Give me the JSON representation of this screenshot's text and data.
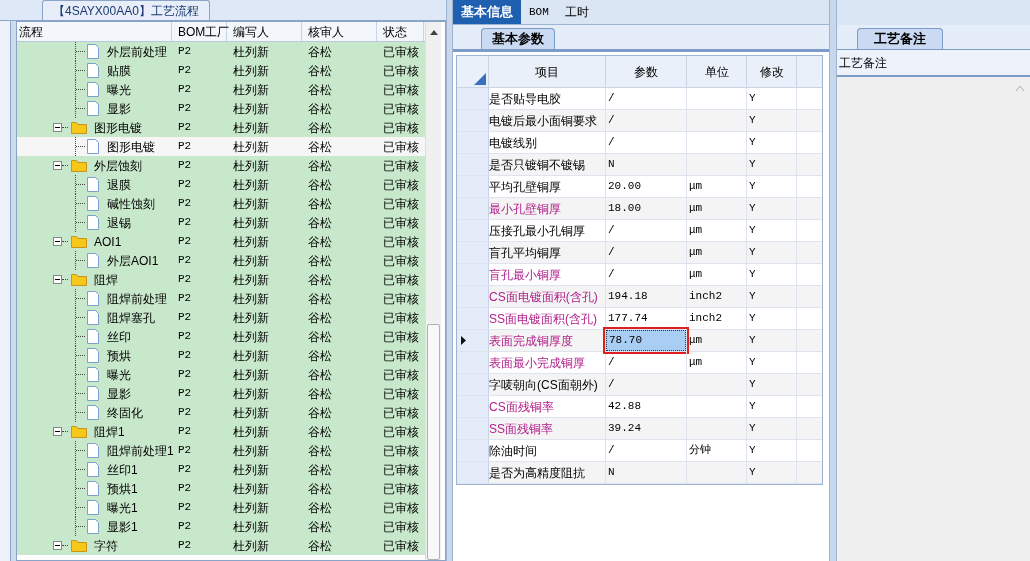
{
  "flow_panel": {
    "title": "【4SAYX00AA0】工艺流程",
    "columns": [
      "流程",
      "BOM工厂",
      "编写人",
      "核审人",
      "状态"
    ],
    "tree": [
      {
        "kind": "leaf",
        "label": "外层前处理",
        "factory": "P2",
        "writer": "杜列新",
        "reviewer": "谷松",
        "status": "已审核",
        "selected": false
      },
      {
        "kind": "leaf",
        "label": "贴膜",
        "factory": "P2",
        "writer": "杜列新",
        "reviewer": "谷松",
        "status": "已审核",
        "selected": false
      },
      {
        "kind": "leaf",
        "label": "曝光",
        "factory": "P2",
        "writer": "杜列新",
        "reviewer": "谷松",
        "status": "已审核",
        "selected": false
      },
      {
        "kind": "leaf",
        "label": "显影",
        "factory": "P2",
        "writer": "杜列新",
        "reviewer": "谷松",
        "status": "已审核",
        "selected": false
      },
      {
        "kind": "folder",
        "label": "图形电镀",
        "factory": "P2",
        "writer": "杜列新",
        "reviewer": "谷松",
        "status": "已审核",
        "selected": false,
        "expanded": true,
        "children": [
          {
            "kind": "leaf",
            "label": "图形电镀",
            "factory": "P2",
            "writer": "杜列新",
            "reviewer": "谷松",
            "status": "已审核",
            "selected": true
          }
        ]
      },
      {
        "kind": "folder",
        "label": "外层蚀刻",
        "factory": "P2",
        "writer": "杜列新",
        "reviewer": "谷松",
        "status": "已审核",
        "selected": false,
        "expanded": true,
        "children": [
          {
            "kind": "leaf",
            "label": "退膜",
            "factory": "P2",
            "writer": "杜列新",
            "reviewer": "谷松",
            "status": "已审核",
            "selected": false
          },
          {
            "kind": "leaf",
            "label": "碱性蚀刻",
            "factory": "P2",
            "writer": "杜列新",
            "reviewer": "谷松",
            "status": "已审核",
            "selected": false
          },
          {
            "kind": "leaf",
            "label": "退锡",
            "factory": "P2",
            "writer": "杜列新",
            "reviewer": "谷松",
            "status": "已审核",
            "selected": false
          }
        ]
      },
      {
        "kind": "folder",
        "label": "AOI1",
        "factory": "P2",
        "writer": "杜列新",
        "reviewer": "谷松",
        "status": "已审核",
        "selected": false,
        "expanded": true,
        "children": [
          {
            "kind": "leaf",
            "label": "外层AOI1",
            "factory": "P2",
            "writer": "杜列新",
            "reviewer": "谷松",
            "status": "已审核",
            "selected": false
          }
        ]
      },
      {
        "kind": "folder",
        "label": "阻焊",
        "factory": "P2",
        "writer": "杜列新",
        "reviewer": "谷松",
        "status": "已审核",
        "selected": false,
        "expanded": true,
        "children": [
          {
            "kind": "leaf",
            "label": "阻焊前处理",
            "factory": "P2",
            "writer": "杜列新",
            "reviewer": "谷松",
            "status": "已审核",
            "selected": false
          },
          {
            "kind": "leaf",
            "label": "阻焊塞孔",
            "factory": "P2",
            "writer": "杜列新",
            "reviewer": "谷松",
            "status": "已审核",
            "selected": false
          },
          {
            "kind": "leaf",
            "label": "丝印",
            "factory": "P2",
            "writer": "杜列新",
            "reviewer": "谷松",
            "status": "已审核",
            "selected": false
          },
          {
            "kind": "leaf",
            "label": "预烘",
            "factory": "P2",
            "writer": "杜列新",
            "reviewer": "谷松",
            "status": "已审核",
            "selected": false
          },
          {
            "kind": "leaf",
            "label": "曝光",
            "factory": "P2",
            "writer": "杜列新",
            "reviewer": "谷松",
            "status": "已审核",
            "selected": false
          },
          {
            "kind": "leaf",
            "label": "显影",
            "factory": "P2",
            "writer": "杜列新",
            "reviewer": "谷松",
            "status": "已审核",
            "selected": false
          },
          {
            "kind": "leaf",
            "label": "终固化",
            "factory": "P2",
            "writer": "杜列新",
            "reviewer": "谷松",
            "status": "已审核",
            "selected": false
          }
        ]
      },
      {
        "kind": "folder",
        "label": "阻焊1",
        "factory": "P2",
        "writer": "杜列新",
        "reviewer": "谷松",
        "status": "已审核",
        "selected": false,
        "expanded": true,
        "children": [
          {
            "kind": "leaf",
            "label": "阻焊前处理1",
            "factory": "P2",
            "writer": "杜列新",
            "reviewer": "谷松",
            "status": "已审核",
            "selected": false
          },
          {
            "kind": "leaf",
            "label": "丝印1",
            "factory": "P2",
            "writer": "杜列新",
            "reviewer": "谷松",
            "status": "已审核",
            "selected": false
          },
          {
            "kind": "leaf",
            "label": "预烘1",
            "factory": "P2",
            "writer": "杜列新",
            "reviewer": "谷松",
            "status": "已审核",
            "selected": false
          },
          {
            "kind": "leaf",
            "label": "曝光1",
            "factory": "P2",
            "writer": "杜列新",
            "reviewer": "谷松",
            "status": "已审核",
            "selected": false
          },
          {
            "kind": "leaf",
            "label": "显影1",
            "factory": "P2",
            "writer": "杜列新",
            "reviewer": "谷松",
            "status": "已审核",
            "selected": false
          }
        ]
      },
      {
        "kind": "folder",
        "label": "字符",
        "factory": "P2",
        "writer": "杜列新",
        "reviewer": "谷松",
        "status": "已审核",
        "selected": false,
        "expanded": true
      }
    ]
  },
  "detail_panel": {
    "tabs": [
      {
        "label": "基本信息",
        "selected": true
      },
      {
        "label": "BOM",
        "selected": false
      },
      {
        "label": "工时",
        "selected": false
      }
    ],
    "subtab": "基本参数",
    "columns": [
      "项目",
      "参数",
      "单位",
      "修改"
    ],
    "rows": [
      {
        "item": "是否贴导电胶",
        "param": "/",
        "unit": "",
        "edit": "Y",
        "required": false,
        "selected": false
      },
      {
        "item": "电镀后最小面铜要求",
        "param": "/",
        "unit": "",
        "edit": "Y",
        "required": false,
        "selected": false
      },
      {
        "item": "电镀线别",
        "param": "/",
        "unit": "",
        "edit": "Y",
        "required": false,
        "selected": false
      },
      {
        "item": "是否只镀铜不镀锡",
        "param": "N",
        "unit": "",
        "edit": "Y",
        "required": false,
        "selected": false
      },
      {
        "item": "平均孔壁铜厚",
        "param": "20.00",
        "unit": "μm",
        "edit": "Y",
        "required": false,
        "selected": false
      },
      {
        "item": "最小孔壁铜厚",
        "param": "18.00",
        "unit": "μm",
        "edit": "Y",
        "required": true,
        "selected": false
      },
      {
        "item": "压接孔最小孔铜厚",
        "param": "/",
        "unit": "μm",
        "edit": "Y",
        "required": false,
        "selected": false
      },
      {
        "item": "盲孔平均铜厚",
        "param": "/",
        "unit": "μm",
        "edit": "Y",
        "required": false,
        "selected": false
      },
      {
        "item": "盲孔最小铜厚",
        "param": "/",
        "unit": "μm",
        "edit": "Y",
        "required": true,
        "selected": false
      },
      {
        "item": "CS面电镀面积(含孔)",
        "param": "194.18",
        "unit": "inch2",
        "edit": "Y",
        "required": true,
        "selected": false
      },
      {
        "item": "SS面电镀面积(含孔)",
        "param": "177.74",
        "unit": "inch2",
        "edit": "Y",
        "required": true,
        "selected": false
      },
      {
        "item": "表面完成铜厚度",
        "param": "78.70",
        "unit": "μm",
        "edit": "Y",
        "required": true,
        "selected": true
      },
      {
        "item": "表面最小完成铜厚",
        "param": "/",
        "unit": "μm",
        "edit": "Y",
        "required": true,
        "selected": false
      },
      {
        "item": "字唛朝向(CS面朝外)",
        "param": "/",
        "unit": "",
        "edit": "Y",
        "required": false,
        "selected": false
      },
      {
        "item": "CS面残铜率",
        "param": "42.88",
        "unit": "",
        "edit": "Y",
        "required": true,
        "selected": false
      },
      {
        "item": "SS面残铜率",
        "param": "39.24",
        "unit": "",
        "edit": "Y",
        "required": true,
        "selected": false
      },
      {
        "item": "除油时间",
        "param": "/",
        "unit": "分钟",
        "edit": "Y",
        "required": false,
        "selected": false
      },
      {
        "item": "是否为高精度阻抗",
        "param": "N",
        "unit": "",
        "edit": "Y",
        "required": false,
        "selected": false
      }
    ]
  },
  "notes_panel": {
    "tab": "工艺备注",
    "label": "工艺备注"
  }
}
